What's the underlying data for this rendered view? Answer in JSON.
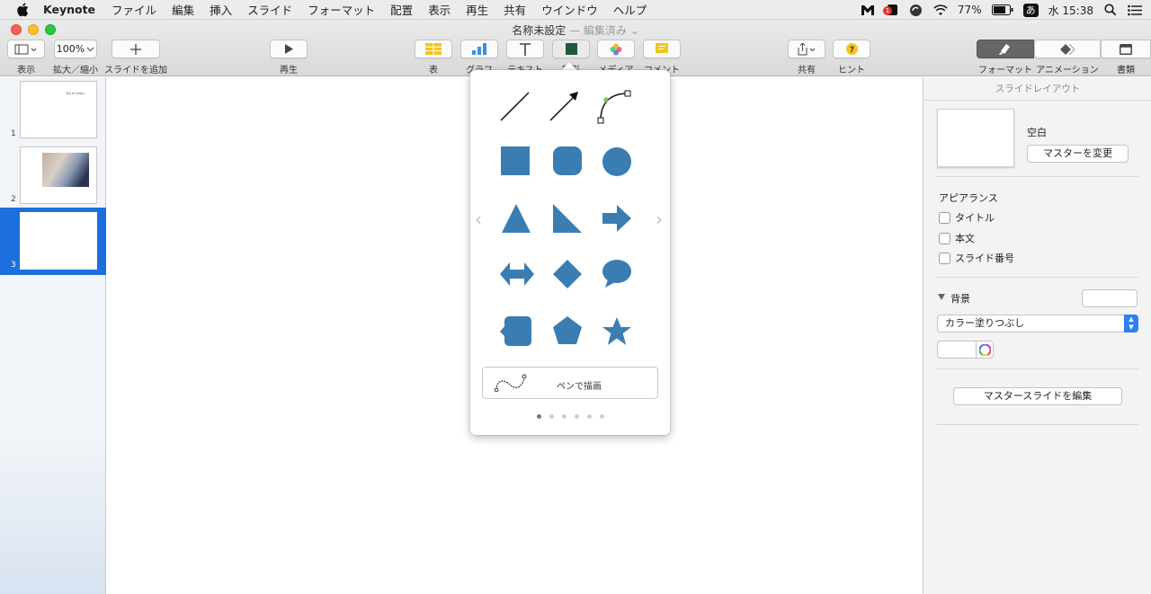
{
  "menubar": {
    "app_name": "Keynote",
    "items": [
      "ファイル",
      "編集",
      "挿入",
      "スライド",
      "フォーマット",
      "配置",
      "表示",
      "再生",
      "共有",
      "ウインドウ",
      "ヘルプ"
    ],
    "battery": "77%",
    "input_method": "あ",
    "clock": "水 15:38",
    "notification_count": "1"
  },
  "window": {
    "title": "名称未設定",
    "subtitle": "— 編集済み ⌄"
  },
  "toolbar": {
    "view_label": "表示",
    "zoom_value": "100%",
    "zoom_label": "拡大／縮小",
    "add_slide_label": "スライドを追加",
    "play_label": "再生",
    "table_label": "表",
    "chart_label": "グラフ",
    "text_label": "テキスト",
    "shape_label": "図形",
    "media_label": "メディア",
    "comment_label": "コメント",
    "share_label": "共有",
    "hint_label": "ヒント",
    "format_label": "フォーマット",
    "animation_label": "アニメーション",
    "document_label": "書類"
  },
  "navigator": {
    "slides": [
      {
        "number": "1",
        "thumb_text": "Tap to begin"
      },
      {
        "number": "2"
      },
      {
        "number": "3"
      }
    ],
    "selected_index": 3
  },
  "shape_popover": {
    "pen_label": "ペンで描画",
    "page_count": 6,
    "active_page": 1,
    "shape_color": "#3a7db3"
  },
  "inspector": {
    "header": "スライドレイアウト",
    "layout_name": "空白",
    "change_master_label": "マスターを変更",
    "appearance_title": "アピアランス",
    "checkbox_title": "タイトル",
    "checkbox_body": "本文",
    "checkbox_slide_number": "スライド番号",
    "background_title": "背景",
    "fill_type": "カラー塗りつぶし",
    "edit_master_label": "マスタースライドを編集"
  }
}
